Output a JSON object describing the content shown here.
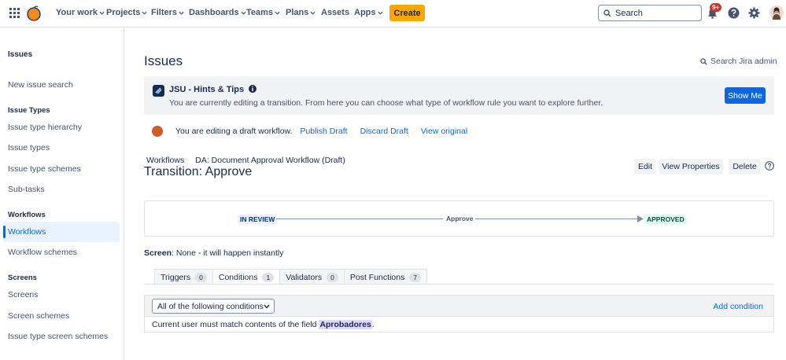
{
  "topnav": {
    "items": [
      {
        "label": "Your work"
      },
      {
        "label": "Projects"
      },
      {
        "label": "Filters"
      },
      {
        "label": "Dashboards"
      },
      {
        "label": "Teams"
      },
      {
        "label": "Plans"
      },
      {
        "label": "Assets"
      },
      {
        "label": "Apps"
      }
    ],
    "create_label": "Create",
    "search_placeholder": "Search",
    "notifications_badge": "9+"
  },
  "sidebar": {
    "header": "Issues",
    "new_issue_search": "New issue search",
    "sections": [
      {
        "title": "Issue Types",
        "items": [
          "Issue type hierarchy",
          "Issue types",
          "Issue type schemes",
          "Sub-tasks"
        ]
      },
      {
        "title": "Workflows",
        "items": [
          "Workflows",
          "Workflow schemes"
        ]
      },
      {
        "title": "Screens",
        "items": [
          "Screens",
          "Screen schemes",
          "Issue type screen schemes"
        ]
      }
    ],
    "active_item": "Workflows"
  },
  "main": {
    "title": "Issues",
    "search_admin": "Search Jira admin",
    "hint": {
      "title": "JSU - Hints & Tips",
      "text": "You are currently editing a transition. From here you can choose what type of workflow rule you want to explore further.",
      "button": "Show Me"
    },
    "draft": {
      "text": "You are editing a draft workflow.",
      "publish": "Publish Draft",
      "discard": "Discard Draft",
      "view_original": "View original"
    },
    "breadcrumb": {
      "root": "Workflows",
      "current": "DA: Document Approval Workflow (Draft)"
    },
    "transition_title": "Transition: Approve",
    "actions": {
      "edit": "Edit",
      "view_properties": "View Properties",
      "delete": "Delete"
    },
    "diagram": {
      "from_status": "IN REVIEW",
      "transition": "Approve",
      "to_status": "APPROVED"
    },
    "screen": {
      "label": "Screen",
      "value": ": None - it will happen instantly"
    },
    "tabs": [
      {
        "label": "Triggers",
        "count": "0"
      },
      {
        "label": "Conditions",
        "count": "1"
      },
      {
        "label": "Validators",
        "count": "0"
      },
      {
        "label": "Post Functions",
        "count": "7"
      }
    ],
    "conditions": {
      "select_value": "All of the following conditions",
      "add_label": "Add condition",
      "rule_prefix": "Current user must match contents of the field",
      "rule_field": "Aprobadores",
      "rule_suffix": "."
    }
  }
}
